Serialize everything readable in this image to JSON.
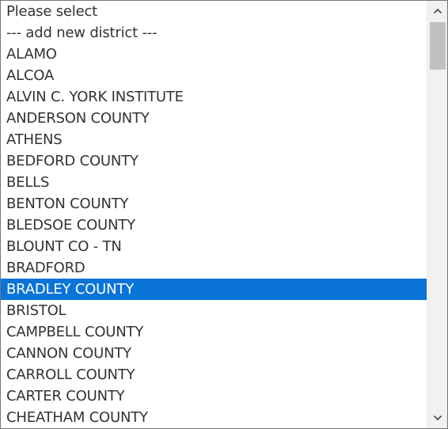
{
  "listbox": {
    "options": [
      "Please select",
      "--- add new district ---",
      "ALAMO",
      "ALCOA",
      "ALVIN C. YORK INSTITUTE",
      "ANDERSON COUNTY",
      "ATHENS",
      "BEDFORD COUNTY",
      "BELLS",
      "BENTON COUNTY",
      "BLEDSOE COUNTY",
      "BLOUNT CO - TN",
      "BRADFORD",
      "BRADLEY COUNTY",
      "BRISTOL",
      "CAMPBELL COUNTY",
      "CANNON COUNTY",
      "CARROLL COUNTY",
      "CARTER COUNTY",
      "CHEATHAM COUNTY"
    ],
    "selected": "BRADLEY COUNTY",
    "selected_index": 13
  },
  "scrollbar": {
    "up_icon": "chevron-up-icon",
    "down_icon": "chevron-down-icon"
  },
  "colors": {
    "selection_background": "#0a74d9",
    "selection_text": "#ffffff",
    "option_text": "#333333",
    "scroll_track": "#f1f1f1",
    "scroll_thumb": "#c1c1c1"
  }
}
